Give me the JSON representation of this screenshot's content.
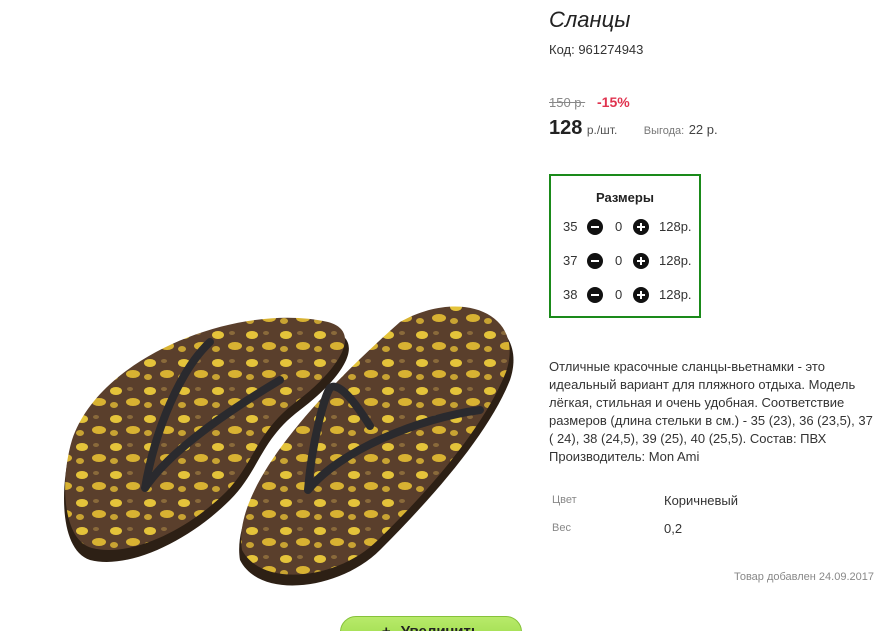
{
  "product": {
    "title": "Сланцы",
    "code": "Код: 961274943",
    "old_price": "150 р.",
    "discount": "-15%",
    "price": "128",
    "price_unit": "р./шт.",
    "savings_label": "Выгода:",
    "savings_value": "22 р."
  },
  "sizes": {
    "title": "Размеры",
    "rows": [
      {
        "size": "35",
        "qty": "0",
        "price": "128р."
      },
      {
        "size": "37",
        "qty": "0",
        "price": "128р."
      },
      {
        "size": "38",
        "qty": "0",
        "price": "128р."
      }
    ]
  },
  "description": "Отличные красочные сланцы-вьетнамки - это идеальный вариант для пляжного отдыха. Модель лёгкая, стильная и очень удобная. Соответствие размеров (длина стельки в см.) - 35 (23), 36 (23,5), 37 ( 24), 38 (24,5), 39 (25), 40 (25,5). Состав: ПВХ Производитель: Mon Ami",
  "properties": [
    {
      "label": "Цвет",
      "value": "Коричневый"
    },
    {
      "label": "Вес",
      "value": "0,2"
    }
  ],
  "added_date": "Товар добавлен 24.09.2017",
  "zoom_button": {
    "label": "Увеличить",
    "icon": "plus-icon"
  },
  "colors": {
    "discount": "#e0334f",
    "sizes_border": "#1a8a1a",
    "zoom_button": "#9ad94a",
    "sole": "#5a3f2c",
    "spots": "#e4c33a",
    "strap": "#2a2a2e"
  }
}
